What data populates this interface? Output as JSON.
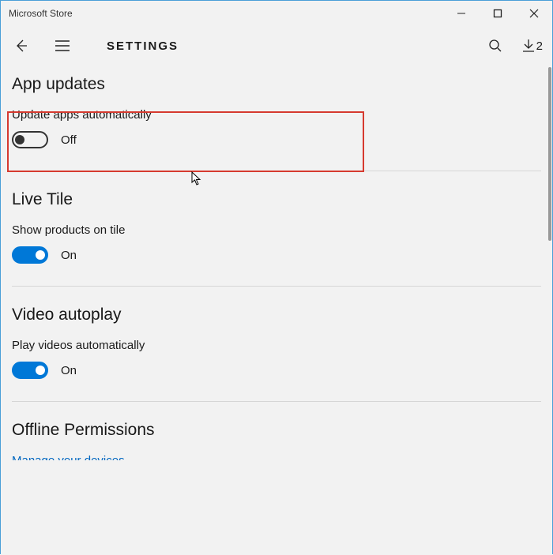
{
  "window": {
    "title": "Microsoft Store"
  },
  "header": {
    "page_title": "SETTINGS",
    "download_count": "2"
  },
  "sections": {
    "app_updates": {
      "heading": "App updates",
      "setting_label": "Update apps automatically",
      "state_label": "Off"
    },
    "live_tile": {
      "heading": "Live Tile",
      "setting_label": "Show products on tile",
      "state_label": "On"
    },
    "video_autoplay": {
      "heading": "Video autoplay",
      "setting_label": "Play videos automatically",
      "state_label": "On"
    },
    "offline_permissions": {
      "heading": "Offline Permissions",
      "link": "Manage your devices"
    }
  }
}
